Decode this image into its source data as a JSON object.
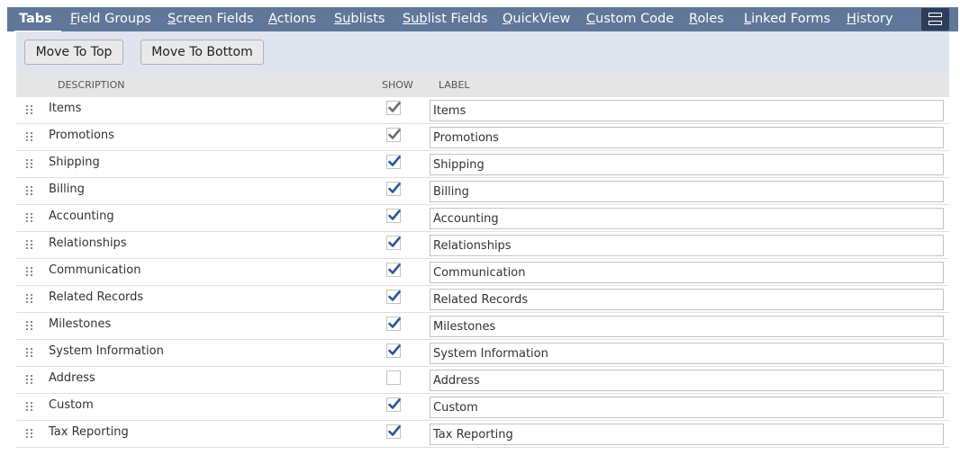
{
  "tabs": [
    {
      "label_u": "Tabs",
      "label_rest": "",
      "active": true
    },
    {
      "label_u": "F",
      "label_rest": "ield Groups"
    },
    {
      "label_u": "S",
      "label_rest": "creen Fields"
    },
    {
      "label_u": "A",
      "label_rest": "ctions"
    },
    {
      "label_u": "Su",
      "label_rest": "blists"
    },
    {
      "label_u": "Sub",
      "label_rest": "list Fields"
    },
    {
      "label_u": "Q",
      "label_rest": "uickView"
    },
    {
      "label_u": "C",
      "label_rest": "ustom Code"
    },
    {
      "label_u": "R",
      "label_rest": "oles"
    },
    {
      "label_u": "L",
      "label_rest": "inked Forms"
    },
    {
      "label_u": "H",
      "label_rest": "istory"
    }
  ],
  "buttons": {
    "move_top": "Move To Top",
    "move_bottom": "Move To Bottom"
  },
  "table": {
    "headers": {
      "description": "DESCRIPTION",
      "show": "SHOW",
      "label": "LABEL"
    },
    "rows": [
      {
        "description": "Items",
        "show": true,
        "disabled": true,
        "label": "Items"
      },
      {
        "description": "Promotions",
        "show": true,
        "disabled": true,
        "label": "Promotions"
      },
      {
        "description": "Shipping",
        "show": true,
        "label": "Shipping"
      },
      {
        "description": "Billing",
        "show": true,
        "label": "Billing"
      },
      {
        "description": "Accounting",
        "show": true,
        "label": "Accounting"
      },
      {
        "description": "Relationships",
        "show": true,
        "label": "Relationships"
      },
      {
        "description": "Communication",
        "show": true,
        "label": "Communication"
      },
      {
        "description": "Related Records",
        "show": true,
        "label": "Related Records"
      },
      {
        "description": "Milestones",
        "show": true,
        "label": "Milestones"
      },
      {
        "description": "System Information",
        "show": true,
        "label": "System Information"
      },
      {
        "description": "Address",
        "show": false,
        "label": "Address"
      },
      {
        "description": "Custom",
        "show": true,
        "label": "Custom"
      },
      {
        "description": "Tax Reporting",
        "show": true,
        "label": "Tax Reporting"
      }
    ]
  },
  "colors": {
    "tab_bar": "#607799",
    "menu_button": "#2d3e58",
    "button_area": "#dfe4ee",
    "check_blue": "#2b5797",
    "check_gray": "#6f6f6f"
  },
  "icons": {
    "menu": "hamburger-icon",
    "grip": "drag-handle-icon",
    "check": "checkmark-icon"
  }
}
